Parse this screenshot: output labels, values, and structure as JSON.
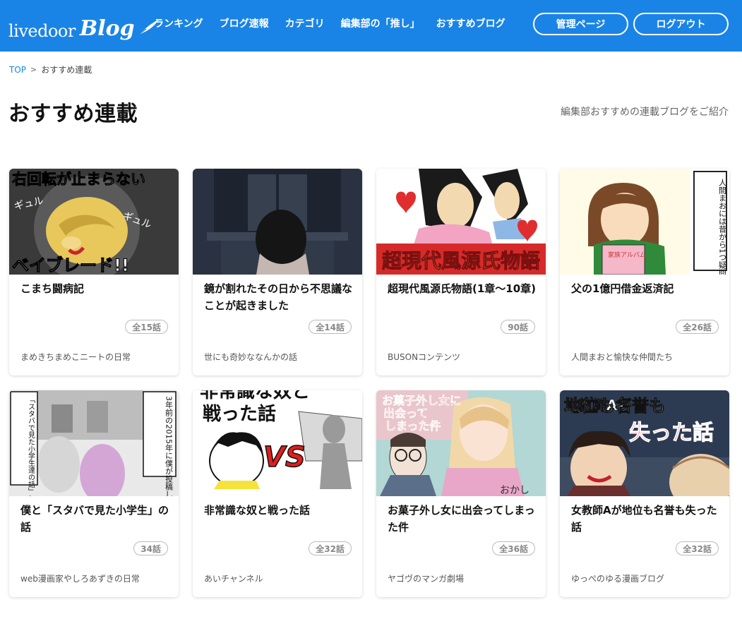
{
  "header": {
    "logo_text": "livedoor",
    "logo_blog": "Blog",
    "nav": [
      "ランキング",
      "ブログ速報",
      "カテゴリ",
      "編集部の「推し」",
      "おすすめブログ"
    ],
    "admin_button": "管理ページ",
    "logout_button": "ログアウト",
    "bg_color": "#1a84e6"
  },
  "breadcrumb": {
    "top": "TOP",
    "separator": ">",
    "current": "おすすめ連載"
  },
  "page": {
    "title": "おすすめ連載",
    "description": "編集部おすすめの連載ブログをご紹介"
  },
  "cards": [
    {
      "title": "こまち闘病記",
      "count": "全15話",
      "author": "まめきちまめこニートの日常",
      "thumb_text": [
        "右回転が止まらない",
        "ギュル",
        "ベイブレード!!"
      ]
    },
    {
      "title": "鏡が割れたその日から不思議なことが起きました",
      "count": "全14話",
      "author": "世にも奇妙ななんかの話",
      "thumb_text": []
    },
    {
      "title": "超現代風源氏物語(1章〜10章)",
      "count": "90話",
      "author": "BUSONコンテンツ",
      "thumb_text": [
        "超現代風源氏物語"
      ]
    },
    {
      "title": "父の1億円借金返済記",
      "count": "全26話",
      "author": "人間まおと愉快な仲間たち",
      "thumb_text": [
        "人間まおには昔から1つ疑問があった",
        "家族アルバム"
      ]
    },
    {
      "title": "僕と「スタバで見た小学生」の話",
      "count": "34話",
      "author": "web漫画家やしろあずきの日常",
      "thumb_text": [
        "「スタバで見た小学生達の話」という漫画がある",
        "3年前の2015年に僕が投稿した"
      ]
    },
    {
      "title": "非常識な奴と戦った話",
      "count": "全32話",
      "author": "あいチャンネル",
      "thumb_text": [
        "非常識な奴と",
        "戦った話",
        "VS"
      ]
    },
    {
      "title": "お菓子外し女に出会ってしまった件",
      "count": "全36話",
      "author": "ヤゴヴのマンガ劇場",
      "thumb_text": [
        "お菓子外し女に",
        "出会って",
        "しまった件",
        "おかし"
      ]
    },
    {
      "title": "女教師Aが地位も名誉も失った話",
      "count": "全32話",
      "author": "ゆっぺのゆる漫画ブログ",
      "thumb_text": [
        "女教師Aが",
        "地位も名誉も",
        "失った話"
      ]
    }
  ]
}
